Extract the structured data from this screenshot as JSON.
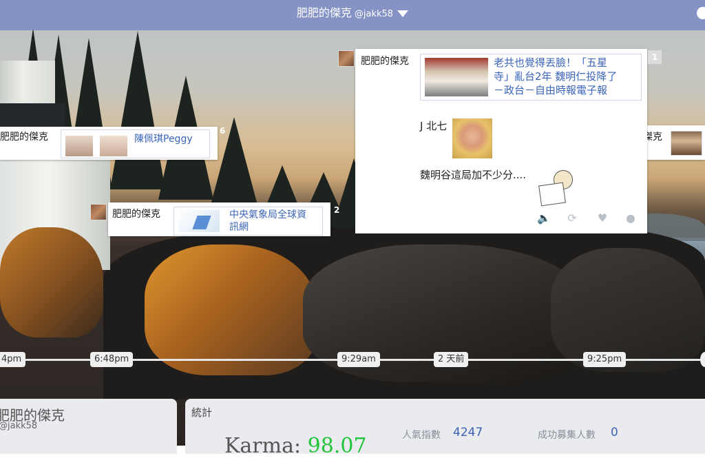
{
  "header": {
    "title": "肥肥的傑克",
    "handle": "@jakk58"
  },
  "cards": {
    "main": {
      "author": "肥肥的傑克",
      "count": "1",
      "link_title_line1": "老共也覺得丟臉！「五星",
      "link_title_line2": "寺」亂台2年 魏明仁投降了",
      "link_title_line3": "－政台－自由時報電子報",
      "text_fragment": "J 北七",
      "text_body": "魏明谷這局加不少分....",
      "actions": [
        "mute-icon",
        "retweet-icon",
        "heart-icon",
        "more-icon"
      ]
    },
    "peggy": {
      "author": "肥肥的傑克",
      "link_title": "陳佩琪Peggy",
      "count": "6"
    },
    "weather": {
      "author": "肥肥的傑克",
      "link_title_line1": "中央氣象局全球資",
      "link_title_line2": "訊網",
      "count": "2"
    },
    "right": {
      "author_fragment": "傑克"
    }
  },
  "timeline": {
    "labels": [
      "4pm",
      "6:48pm",
      "9:29am",
      "2 天前",
      "9:25pm"
    ]
  },
  "profile": {
    "name": "肥肥的傑克",
    "handle": "@jakk58"
  },
  "stats": {
    "heading": "統計",
    "karma_label": "Karma:",
    "karma_value": "98.07",
    "popularity_label": "人氣指數",
    "popularity_value": "4247",
    "recruits_label": "成功募集人數",
    "recruits_value": "0"
  },
  "colors": {
    "topbar": "#7887c3",
    "link": "#3b64b8",
    "karma_value": "#21c43a",
    "stat_value": "#3f62b5"
  }
}
